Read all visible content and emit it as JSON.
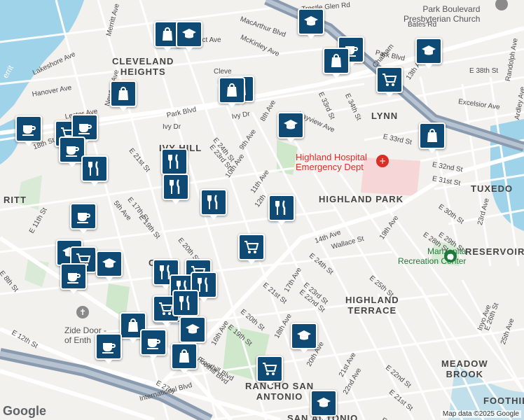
{
  "map": {
    "google_logo": "Google",
    "attribution": "Map data ©2025 Google",
    "colors": {
      "background": "#f2f1ee",
      "water": "#9fd3ea",
      "park": "#cfe8cc",
      "hospital": "#f6d6d6",
      "freeway": "#8a9bb0",
      "marker": "#0e4a73"
    }
  },
  "area_labels": [
    {
      "text": "CLEVELAND\nHEIGHTS"
    },
    {
      "text": "IVY HILL"
    },
    {
      "text": "LYNN"
    },
    {
      "text": "TUXEDO"
    },
    {
      "text": "HIGHLAND PARK"
    },
    {
      "text": "RESERVOIR"
    },
    {
      "text": "HIGHLAND\nTERRACE"
    },
    {
      "text": "MEADOW\nBROOK"
    },
    {
      "text": "RANCHO SAN\nANTONIO"
    },
    {
      "text": "CL"
    },
    {
      "text": "RITT"
    },
    {
      "text": "FOOTHIL"
    },
    {
      "text": "SAN ANTONIO"
    }
  ],
  "poi_labels": [
    {
      "text": "Park Boulevard\nPresbyterian Church",
      "kind": "gray"
    },
    {
      "text": "Highland Hospital\nEmergency Dept",
      "kind": "red"
    },
    {
      "text": "Manzanita\nRecreation Center",
      "kind": "grn"
    },
    {
      "text": "Zide Door -\nof Enth",
      "kind": "gray"
    },
    {
      "text": "errit",
      "kind": "blue"
    }
  ],
  "street_labels": [
    "MacArthur Blvd",
    "Trestle Glen Rd",
    "Bates Rd",
    "McKinley Ave",
    "Merritt Ave",
    "Lakeshore Ave",
    "Hanover Ave",
    "Newton Ave",
    "Lester Ave",
    "Park Blvd",
    "Ivy Dr",
    "8th Ave",
    "Bayview Ave",
    "E 33rd St",
    "E 34th St",
    "Park Blvd",
    "13th Ave",
    "E 38th St",
    "Randolph Ave",
    "Excelsior Ave",
    "Ardley Ave",
    "E 33rd St",
    "E 32nd St",
    "E 31st St",
    "E 30th St",
    "23rd Ave",
    "E 29th St",
    "E 28th St",
    "19th Ave",
    "Wallace St",
    "14th Ave",
    "E 24th St",
    "E 23rd St",
    "E 22nd St",
    "E 25th St",
    "17th Ave",
    "E 21st St",
    "E 20th St",
    "E 19th St",
    "16th Ave",
    "Foothill Blvd",
    "18th Ave",
    "20th Ave",
    "21st Ave",
    "22nd Ave",
    "E 22nd St",
    "E 21st St",
    "E 20th",
    "Inyo Ave",
    "E 26th St",
    "25th Ave",
    "E 27th",
    "International Blvd",
    "E 12th St",
    "E 8th St",
    "E 11th St",
    "5th Ave",
    "7th Ave",
    "E 17th St",
    "E 19th St",
    "E 20th St",
    "E 21st St",
    "E 23rd St",
    "E 24th St",
    "9th Ave",
    "10th Ave",
    "11th Ave",
    "12th",
    "Foothill Blvd",
    "18th St",
    "Ivy Dr",
    "Cleve",
    "ect Ave",
    "Chatham"
  ],
  "markers": [
    {
      "icon": "shopping-bag-icon"
    },
    {
      "icon": "school-icon"
    },
    {
      "icon": "school-icon"
    },
    {
      "icon": "shopping-bag-icon"
    },
    {
      "icon": "shopping-bag-icon"
    },
    {
      "icon": "coffee-icon"
    },
    {
      "icon": "school-icon"
    },
    {
      "icon": "shopping-cart-icon"
    },
    {
      "icon": "shopping-bag-icon"
    },
    {
      "icon": "shopping-bag-icon"
    },
    {
      "icon": "coffee-icon"
    },
    {
      "icon": "shopping-cart-icon"
    },
    {
      "icon": "coffee-icon"
    },
    {
      "icon": "coffee-icon"
    },
    {
      "icon": "school-icon"
    },
    {
      "icon": "shopping-bag-icon"
    },
    {
      "icon": "restaurant-icon"
    },
    {
      "icon": "restaurant-icon"
    },
    {
      "icon": "restaurant-icon"
    },
    {
      "icon": "restaurant-icon"
    },
    {
      "icon": "coffee-icon"
    },
    {
      "icon": "restaurant-icon"
    },
    {
      "icon": "shopping-cart-icon"
    },
    {
      "icon": "school-icon"
    },
    {
      "icon": "shopping-cart-icon"
    },
    {
      "icon": "school-icon"
    },
    {
      "icon": "coffee-icon"
    },
    {
      "icon": "restaurant-icon"
    },
    {
      "icon": "shopping-cart-icon"
    },
    {
      "icon": "restaurant-icon"
    },
    {
      "icon": "restaurant-icon"
    },
    {
      "icon": "shopping-cart-icon"
    },
    {
      "icon": "shopping-cart-icon"
    },
    {
      "icon": "restaurant-icon"
    },
    {
      "icon": "shopping-bag-icon"
    },
    {
      "icon": "school-icon"
    },
    {
      "icon": "coffee-icon"
    },
    {
      "icon": "coffee-icon"
    },
    {
      "icon": "shopping-bag-icon"
    },
    {
      "icon": "school-icon"
    },
    {
      "icon": "shopping-cart-icon"
    },
    {
      "icon": "school-icon"
    }
  ]
}
